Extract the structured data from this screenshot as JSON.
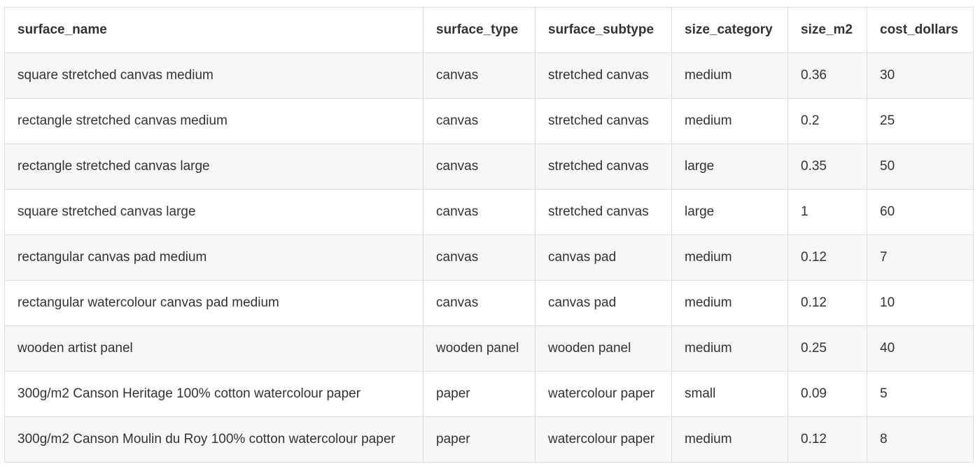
{
  "table": {
    "columns": [
      "surface_name",
      "surface_type",
      "surface_subtype",
      "size_category",
      "size_m2",
      "cost_dollars"
    ],
    "rows": [
      [
        "square stretched canvas medium",
        "canvas",
        "stretched canvas",
        "medium",
        "0.36",
        "30"
      ],
      [
        "rectangle stretched canvas medium",
        "canvas",
        "stretched canvas",
        "medium",
        "0.2",
        "25"
      ],
      [
        "rectangle stretched canvas large",
        "canvas",
        "stretched canvas",
        "large",
        "0.35",
        "50"
      ],
      [
        "square stretched canvas large",
        "canvas",
        "stretched canvas",
        "large",
        "1",
        "60"
      ],
      [
        "rectangular canvas pad medium",
        "canvas",
        "canvas pad",
        "medium",
        "0.12",
        "7"
      ],
      [
        "rectangular watercolour canvas pad medium",
        "canvas",
        "canvas pad",
        "medium",
        "0.12",
        "10"
      ],
      [
        "wooden artist panel",
        "wooden panel",
        "wooden panel",
        "medium",
        "0.25",
        "40"
      ],
      [
        "300g/m2 Canson Heritage 100% cotton watercolour paper",
        "paper",
        "watercolour paper",
        "small",
        "0.09",
        "5"
      ],
      [
        "300g/m2 Canson Moulin du Roy 100% cotton watercolour paper",
        "paper",
        "watercolour paper",
        "medium",
        "0.12",
        "8"
      ]
    ]
  }
}
